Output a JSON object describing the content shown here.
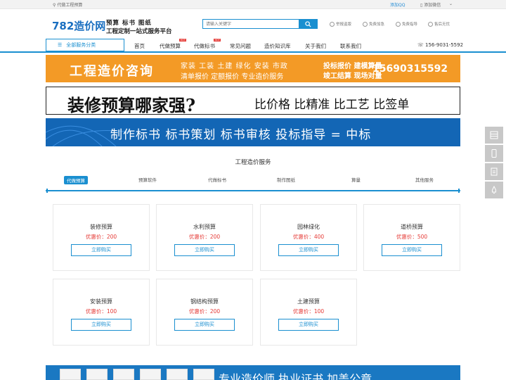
{
  "topbar": {
    "location": "代做工程预算",
    "qq": "添加QQ",
    "wechat": "添加微信"
  },
  "header": {
    "logo": "782造价网",
    "slogan_line1": "预算 标书 图纸",
    "slogan_line2": "工程定制一站式服务平台",
    "search": {
      "placeholder": "请输入关键字"
    },
    "features": [
      "举报盗版",
      "免费加急",
      "免费指导",
      "售后无忧"
    ]
  },
  "nav": {
    "all_categories": "全部服务分类",
    "items": [
      "首页",
      "代做预算",
      "代做标书",
      "常见问题",
      "造价知识库",
      "关于我们",
      "联系我们"
    ],
    "hot_badge": "HOT",
    "phone": "156-9031-5592"
  },
  "banner1": {
    "title": "工程造价咨询",
    "line1": "家装 工装 土建 绿化 安装 市政",
    "line2": "清单报价 定额报价 专业造价服务",
    "line3": "投标报价 建模算量",
    "line4": "竣工结算 现场对量",
    "phone": "15690315592"
  },
  "banner2": {
    "title": "装修预算哪家强?",
    "subtitle": "比价格 比精准 比工艺 比签单"
  },
  "banner3": {
    "title": "制作标书 标书策划 标书审核 投标指导 = 中标"
  },
  "section": {
    "title": "工程造价服务",
    "tabs": [
      "代做预算",
      "预算软件",
      "代做标书",
      "制作图纸",
      "算量",
      "其他服务"
    ]
  },
  "services": [
    {
      "name": "装修预算",
      "price": "优惠价：200",
      "button": "立即购买"
    },
    {
      "name": "水利预算",
      "price": "优惠价：200",
      "button": "立即购买"
    },
    {
      "name": "园林绿化",
      "price": "优惠价：400",
      "button": "立即购买"
    },
    {
      "name": "道桥预算",
      "price": "优惠价：500",
      "button": "立即购买"
    },
    {
      "name": "安装预算",
      "price": "优惠价：100",
      "button": "立即购买"
    },
    {
      "name": "钢结构预算",
      "price": "优惠价：200",
      "button": "立即购买"
    },
    {
      "name": "土建预算",
      "price": "优惠价：100",
      "button": "立即购买"
    }
  ],
  "bottom_banner": {
    "text": "专业造价师 执业证书 加盖公章"
  },
  "colors": {
    "brand": "#1a8fd0",
    "orange": "#f39a26",
    "price": "#e53935",
    "banner_blue": "#1366b5"
  }
}
